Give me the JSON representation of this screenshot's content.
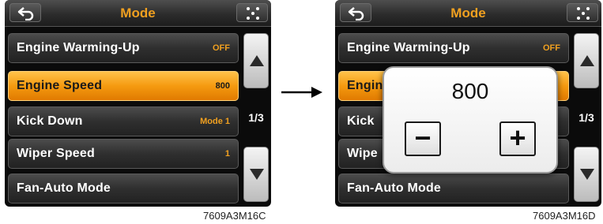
{
  "left_screen": {
    "title": "Mode",
    "page_indicator": "1/3",
    "items": [
      {
        "label": "Engine Warming-Up",
        "value": "OFF"
      },
      {
        "label": "Engine Speed",
        "value": "800"
      },
      {
        "label": "Kick Down",
        "value": "Mode 1"
      },
      {
        "label": "Wiper Speed",
        "value": "1"
      },
      {
        "label": "Fan-Auto Mode",
        "value": ""
      }
    ],
    "caption": "7609A3M16C"
  },
  "right_screen": {
    "title": "Mode",
    "page_indicator": "1/3",
    "items": [
      {
        "label": "Engine Warming-Up",
        "value": "OFF"
      },
      {
        "label": "Engin",
        "value": ""
      },
      {
        "label": "Kick",
        "value": ""
      },
      {
        "label": "Wipe",
        "value": ""
      },
      {
        "label": "Fan-Auto Mode",
        "value": ""
      }
    ],
    "popup": {
      "value": "800",
      "minus_label": "−",
      "plus_label": "+"
    },
    "caption": "7609A3M16D"
  },
  "icons": {
    "back": "back-arrow-icon",
    "menu": "dots-menu-icon",
    "scroll_up": "triangle-up-icon",
    "scroll_down": "triangle-down-icon",
    "transition": "right-arrow-icon"
  },
  "colors": {
    "title_accent": "#f0a020",
    "selected_row": "#f59a10"
  }
}
